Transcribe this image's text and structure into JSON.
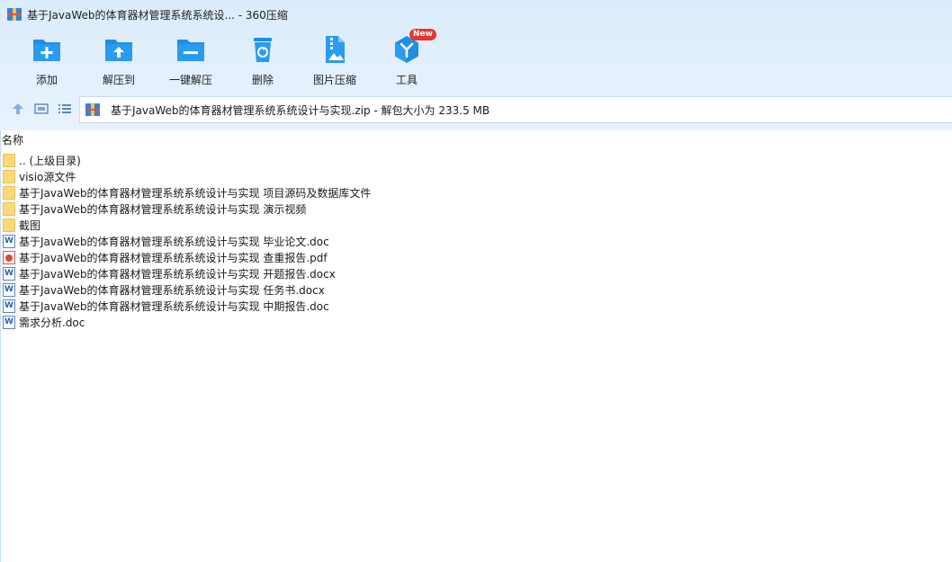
{
  "window": {
    "title": "基于JavaWeb的体育器材管理系统系统设... - 360压缩"
  },
  "toolbar": {
    "items": [
      {
        "label": "添加",
        "icon": "folder-add-icon"
      },
      {
        "label": "解压到",
        "icon": "folder-extract-icon"
      },
      {
        "label": "一键解压",
        "icon": "folder-oneclick-icon"
      },
      {
        "label": "删除",
        "icon": "trash-icon"
      },
      {
        "label": "图片压缩",
        "icon": "image-compress-icon"
      },
      {
        "label": "工具",
        "icon": "tools-icon"
      }
    ],
    "new_badge": "New"
  },
  "nav": {
    "path": "基于JavaWeb的体育器材管理系统系统设计与实现.zip - 解包大小为 233.5 MB"
  },
  "list": {
    "column_name": "名称",
    "rows": [
      {
        "name": ".. (上级目录)",
        "type": "folder"
      },
      {
        "name": "visio源文件",
        "type": "folder"
      },
      {
        "name": "基于JavaWeb的体育器材管理系统系统设计与实现 项目源码及数据库文件",
        "type": "folder"
      },
      {
        "name": "基于JavaWeb的体育器材管理系统系统设计与实现 演示视频",
        "type": "folder"
      },
      {
        "name": "截图",
        "type": "folder"
      },
      {
        "name": "基于JavaWeb的体育器材管理系统系统设计与实现 毕业论文.doc",
        "type": "doc"
      },
      {
        "name": "基于JavaWeb的体育器材管理系统系统设计与实现 查重报告.pdf",
        "type": "pdf"
      },
      {
        "name": "基于JavaWeb的体育器材管理系统系统设计与实现 开题报告.docx",
        "type": "doc"
      },
      {
        "name": "基于JavaWeb的体育器材管理系统系统设计与实现 任务书.docx",
        "type": "doc"
      },
      {
        "name": "基于JavaWeb的体育器材管理系统系统设计与实现 中期报告.doc",
        "type": "doc"
      },
      {
        "name": "需求分析.doc",
        "type": "doc"
      }
    ]
  },
  "colors": {
    "accent": "#1f8fe6",
    "badge": "#e8362e",
    "folder": "#fbd97a"
  }
}
